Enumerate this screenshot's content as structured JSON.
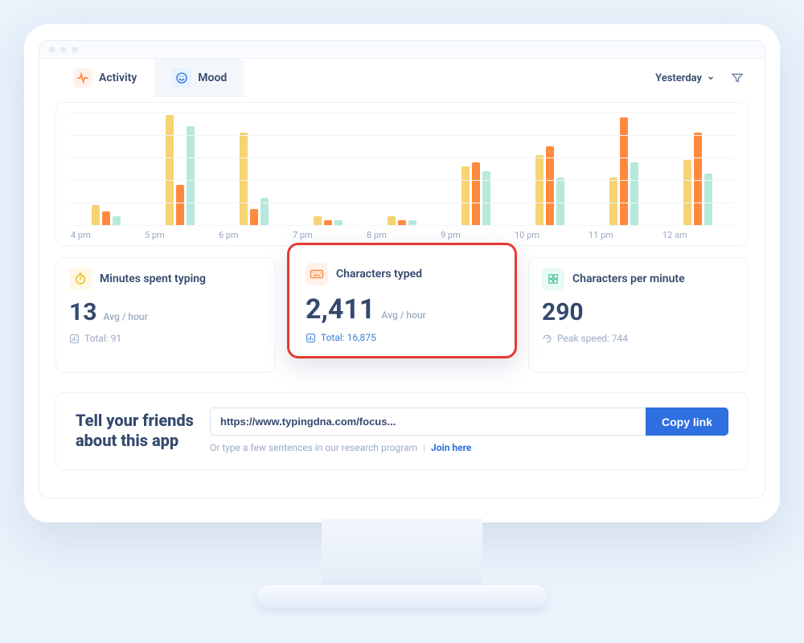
{
  "tabs": {
    "activity": "Activity",
    "mood": "Mood"
  },
  "period": {
    "label": "Yesterday"
  },
  "chart_data": {
    "type": "bar",
    "title": "",
    "xlabel": "",
    "ylabel": "",
    "ylim": [
      0,
      100
    ],
    "categories": [
      "4 pm",
      "5 pm",
      "6 pm",
      "7 pm",
      "8 pm",
      "9 pm",
      "10 pm",
      "11 pm",
      "12 am"
    ],
    "series": [
      {
        "name": "Minutes spent typing",
        "color": "#f6d373",
        "values": [
          18,
          98,
          82,
          8,
          8,
          52,
          62,
          42,
          58
        ]
      },
      {
        "name": "Characters typed",
        "color": "#ff8a3d",
        "values": [
          12,
          36,
          14,
          4,
          4,
          56,
          70,
          96,
          82
        ]
      },
      {
        "name": "Characters per minute",
        "color": "#b6e9db",
        "values": [
          8,
          88,
          24,
          4,
          4,
          48,
          42,
          56,
          46
        ]
      }
    ]
  },
  "stats": {
    "minutes": {
      "title": "Minutes spent typing",
      "value": "13",
      "unit": "Avg / hour",
      "foot": "Total: 91"
    },
    "chars": {
      "title": "Characters typed",
      "value": "2,411",
      "unit": "Avg / hour",
      "foot": "Total: 16,875"
    },
    "cpm": {
      "title": "Characters per minute",
      "value": "290",
      "unit": "",
      "foot": "Peak speed: 744"
    }
  },
  "share": {
    "title_line1": "Tell your friends",
    "title_line2": "about this app",
    "url": "https://www.typingdna.com/focus...",
    "copy": "Copy link",
    "sub_text": "Or type a few sentences in our research program",
    "join": "Join here"
  }
}
